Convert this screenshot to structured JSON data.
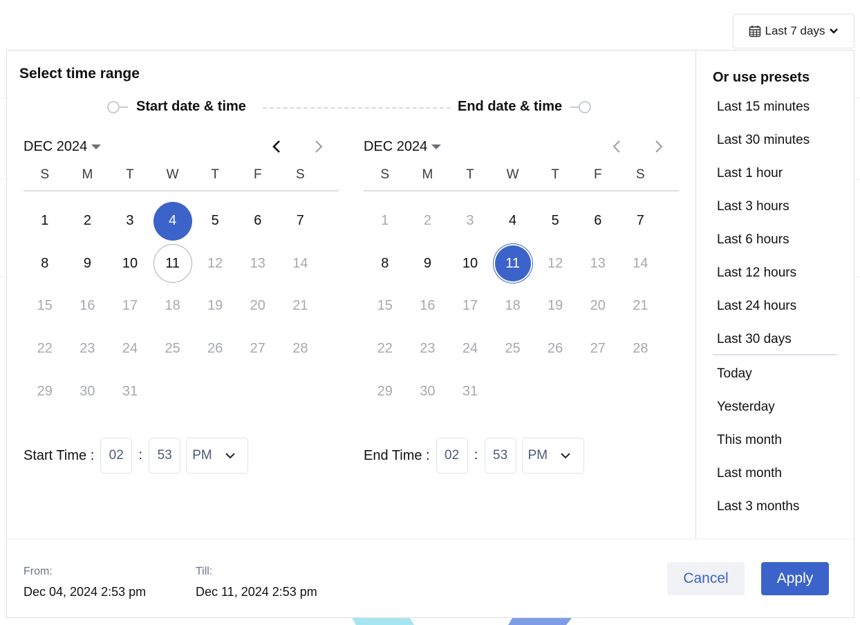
{
  "trigger": {
    "label": "Last 7 days"
  },
  "picker": {
    "title": "Select time range",
    "start_step": "Start date & time",
    "end_step": "End date & time"
  },
  "weekdays": [
    "S",
    "M",
    "T",
    "W",
    "T",
    "F",
    "S"
  ],
  "start_calendar": {
    "month_label": "DEC 2024",
    "selected_day": 4,
    "range_end_day": 11,
    "enabled_until": 11,
    "days_in_month": 31
  },
  "end_calendar": {
    "month_label": "DEC 2024",
    "selected_day": 11,
    "enabled_from": 4,
    "enabled_until": 11,
    "days_in_month": 31
  },
  "start_time": {
    "label": "Start Time :",
    "hour": "02",
    "minute": "53",
    "period": "PM",
    "separator": ":"
  },
  "end_time": {
    "label": "End Time :",
    "hour": "02",
    "minute": "53",
    "period": "PM",
    "separator": ":"
  },
  "presets": {
    "title": "Or use presets",
    "group1": [
      "Last 15 minutes",
      "Last 30 minutes",
      "Last 1 hour",
      "Last 3 hours",
      "Last 6 hours",
      "Last 12 hours",
      "Last 24 hours",
      "Last 30 days"
    ],
    "group2": [
      "Today",
      "Yesterday",
      "This month",
      "Last month",
      "Last 3 months"
    ]
  },
  "footer": {
    "from_label": "From:",
    "from_value": "Dec 04, 2024 2:53 pm",
    "till_label": "Till:",
    "till_value": "Dec 11, 2024 2:53 pm",
    "cancel_label": "Cancel",
    "apply_label": "Apply"
  },
  "colors": {
    "accent": "#3b63c9",
    "muted_text": "#a6a9ae",
    "decor_cyan": "#a6e6f0",
    "decor_blue": "#7f9ce6"
  }
}
